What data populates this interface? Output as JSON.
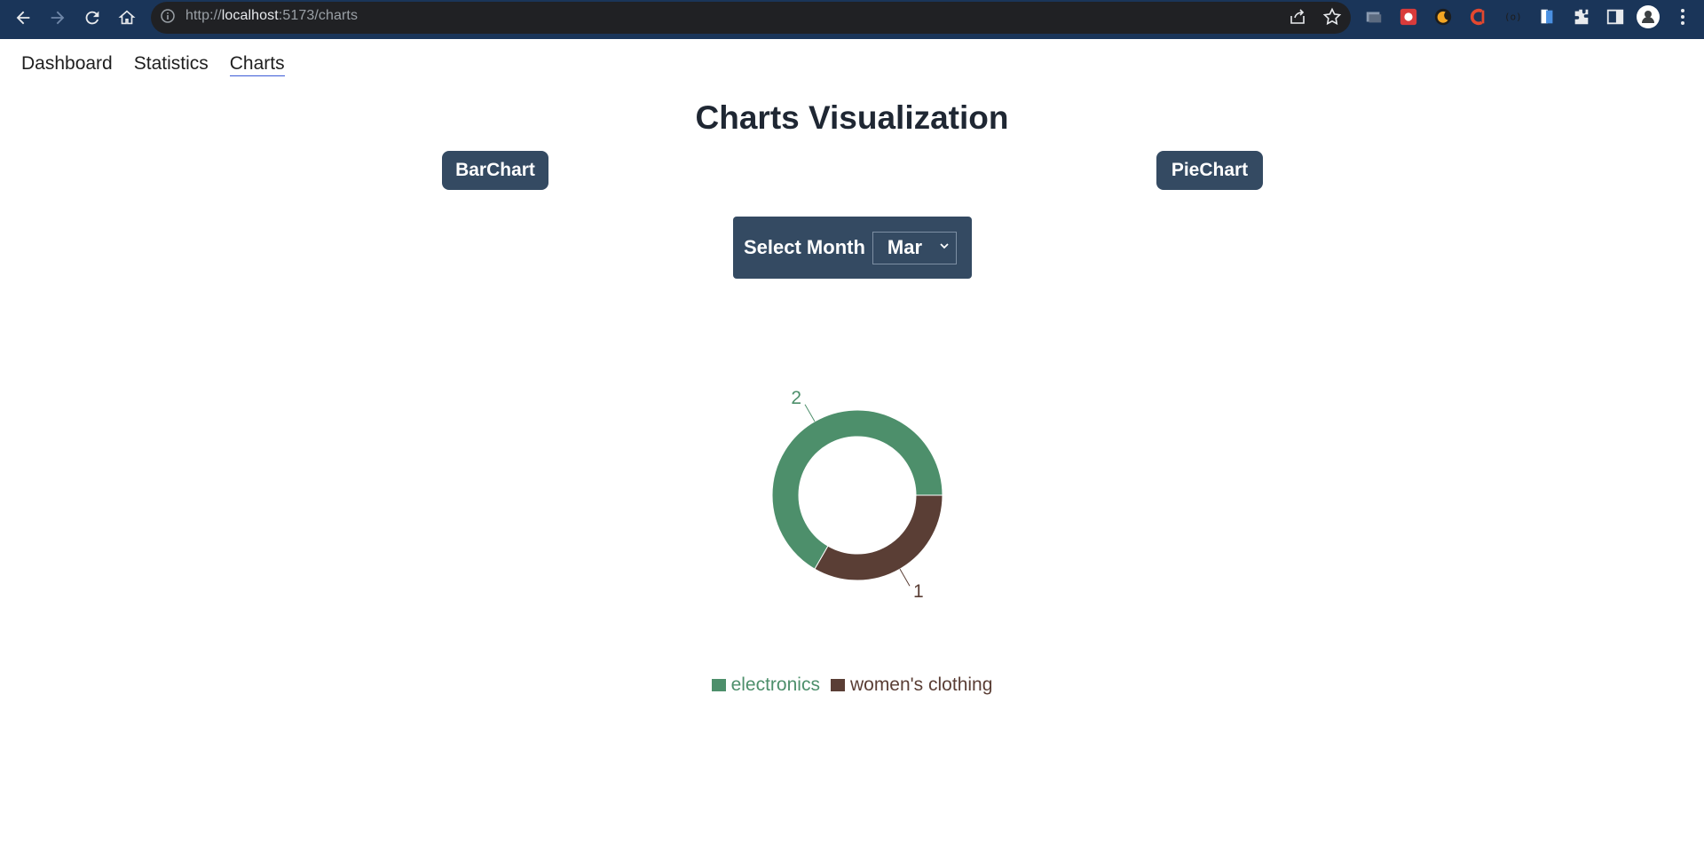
{
  "browser": {
    "url_scheme": "http://",
    "url_host": "localhost",
    "url_path": ":5173/charts"
  },
  "nav": {
    "items": [
      {
        "label": "Dashboard"
      },
      {
        "label": "Statistics"
      },
      {
        "label": "Charts"
      }
    ],
    "active": "Charts"
  },
  "page": {
    "title": "Charts Visualization",
    "bar_button": "BarChart",
    "pie_button": "PieChart",
    "month_label": "Select Month",
    "month_value": "Mar"
  },
  "colors": {
    "accent": "#344a62",
    "electronics": "#4d8f6b",
    "womens_clothing": "#5a3e35"
  },
  "chart_data": {
    "type": "pie",
    "donut": true,
    "categories": [
      "electronics",
      "women's clothing"
    ],
    "values": [
      2,
      1
    ],
    "data_labels": [
      "2",
      "1"
    ],
    "legend_position": "bottom-center"
  }
}
